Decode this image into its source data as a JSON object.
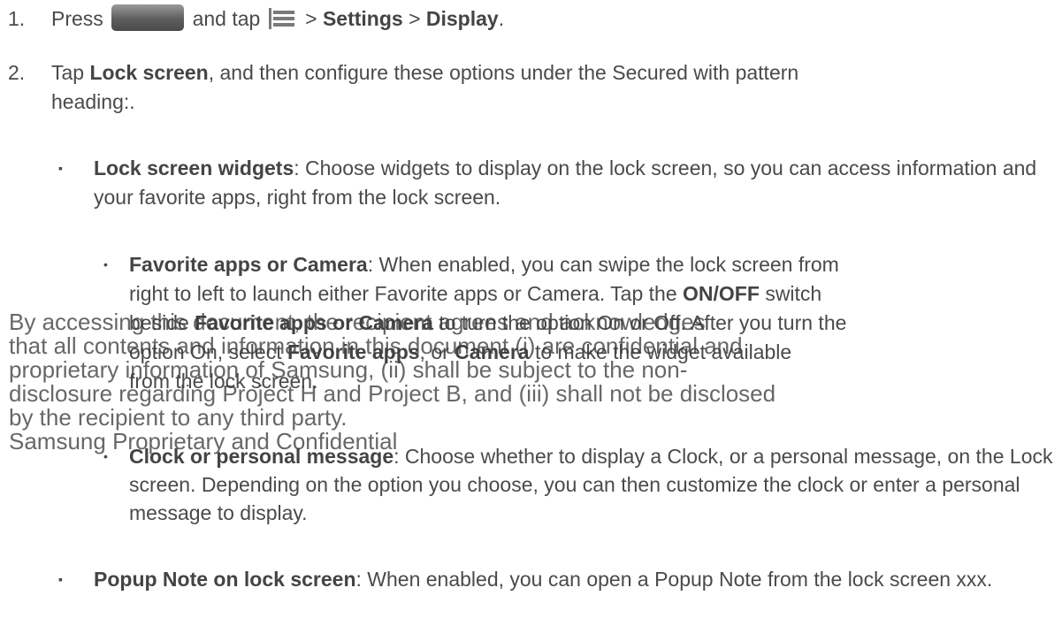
{
  "step1": {
    "number": "1.",
    "press": "Press",
    "home_button_icon": "home-button-icon",
    "and_tap": "and tap",
    "menu_icon": "menu-icon",
    "sep1": ">",
    "settings": "Settings",
    "sep2": ">",
    "display": "Display",
    "end": "."
  },
  "step2": {
    "number": "2.",
    "tap": "Tap",
    "lock_screen": "Lock screen",
    "rest": ", and then configure these options under the Secured with pattern heading:."
  },
  "bullets": {
    "square_mark": "▪",
    "dot_mark": "•",
    "widgets_title": "Lock screen widgets",
    "widgets_text": ": Choose widgets to display on the lock screen, so you can access information and your favorite apps, right from the lock screen.",
    "favorite_title": "Favorite apps or Camera",
    "favorite_line1": ": When enabled, you can swipe the lock screen from",
    "favorite_line2_a": "right to left to launch either Favorite apps or Camera. Tap the",
    "favorite_onoff": "ON/OFF",
    "favorite_line2_b": "switch",
    "favorite_line3_a": "beside",
    "favorite_fac": "Favorite apps or Camera",
    "favorite_line3_b": "to turn the option On or Off. After you turn the",
    "favorite_line4_a": "option On, select",
    "favorite_apps": "Favorite apps",
    "favorite_or": ", or",
    "favorite_camera": "Camera",
    "favorite_line4_b": "to make the widget available",
    "favorite_line5": "from the lock screen.",
    "clock_title": "Clock or personal message",
    "clock_text": ": Choose whether to display a Clock, or a personal message, on the Lock screen. Depending on the option you choose, you can then customize the clock or enter a personal message to display.",
    "popup_title": "Popup Note on lock screen",
    "popup_text": ": When enabled, you can open a Popup Note from the lock screen xxx."
  },
  "watermark": {
    "line1": "By accessing this document, the recipient agrees and acknowledges",
    "line2": "that all contents and information in this document (i) are confidential and",
    "line3": "proprietary information of Samsung, (ii) shall be subject to the non-",
    "line4": "disclosure regarding Project H and Project B, and (iii) shall not be disclosed",
    "line5": "by the recipient to any third party.",
    "line6": "Samsung Proprietary and Confidential"
  }
}
